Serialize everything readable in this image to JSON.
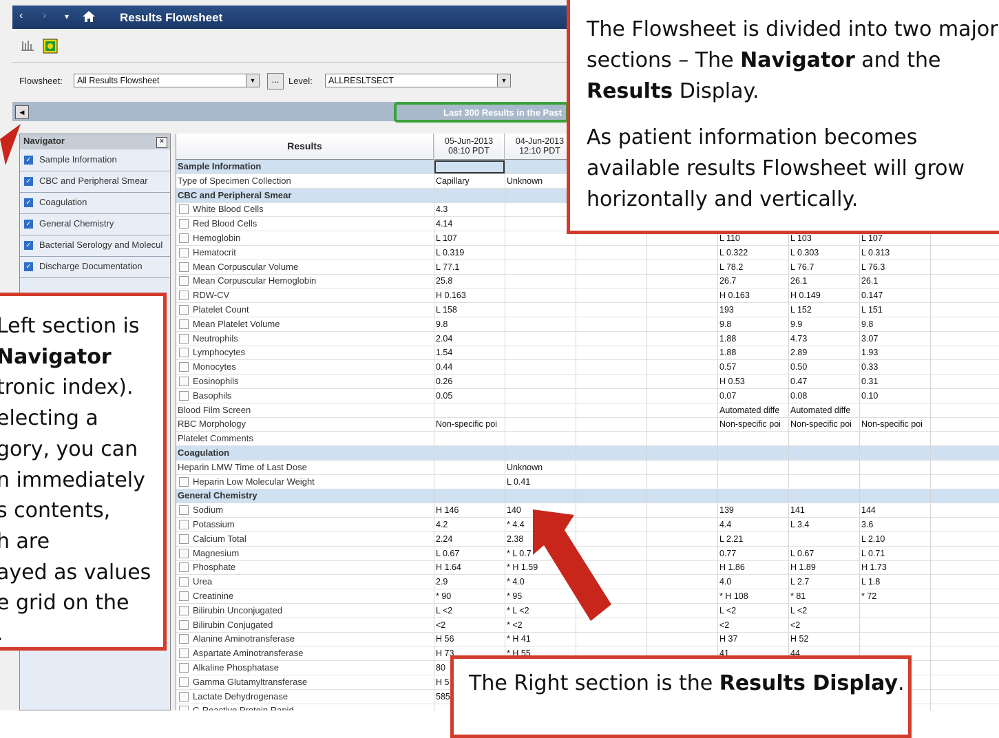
{
  "window": {
    "title": "Results Flowsheet",
    "back_arrow": "‹",
    "forward_arrow": "›",
    "dropdown_arrow": "▾",
    "home_icon": "home-icon"
  },
  "filters": {
    "flowsheet_label": "Flowsheet:",
    "flowsheet_value": "All Results Flowsheet",
    "ellipsis": "...",
    "level_label": "Level:",
    "level_value": "ALLRESLTSECT",
    "range_label": "Last 300 Results in the Past"
  },
  "navigator": {
    "title": "Navigator",
    "items": [
      {
        "label": "Sample Information"
      },
      {
        "label": "CBC and Peripheral Smear"
      },
      {
        "label": "Coagulation"
      },
      {
        "label": "General Chemistry"
      },
      {
        "label": "Bacterial Serology and Molecul"
      },
      {
        "label": "Discharge Documentation"
      }
    ]
  },
  "grid": {
    "results_header": "Results",
    "column_headers": [
      {
        "date": "05-Jun-2013",
        "time": "08:10 PDT"
      },
      {
        "date": "04-Jun-2013",
        "time": "12:10 PDT"
      }
    ],
    "rows": [
      {
        "type": "section",
        "name": "Sample Information",
        "values": [
          "",
          "",
          "",
          "",
          "",
          "",
          ""
        ]
      },
      {
        "type": "plain",
        "name": "Type of Specimen Collection",
        "values": [
          "Capillary",
          "Unknown",
          "",
          "",
          "",
          "",
          ""
        ]
      },
      {
        "type": "section",
        "name": "CBC and Peripheral Smear",
        "values": [
          "",
          "",
          "",
          "",
          "",
          "",
          ""
        ]
      },
      {
        "type": "check",
        "name": "White Blood Cells",
        "values": [
          "4.3",
          "",
          "",
          "",
          "",
          "",
          ""
        ]
      },
      {
        "type": "check",
        "name": "Red Blood Cells",
        "values": [
          "4.14",
          "",
          "",
          "",
          "",
          "",
          ""
        ]
      },
      {
        "type": "check",
        "name": "Hemoglobin",
        "values": [
          "L 107",
          "",
          "",
          "",
          "L 110",
          "L 103",
          "L 107"
        ]
      },
      {
        "type": "check",
        "name": "Hematocrit",
        "values": [
          "L 0.319",
          "",
          "",
          "",
          "L 0.322",
          "L 0.303",
          "L 0.313"
        ]
      },
      {
        "type": "check",
        "name": "Mean Corpuscular Volume",
        "values": [
          "L 77.1",
          "",
          "",
          "",
          "L 78.2",
          "L 76.7",
          "L 76.3"
        ]
      },
      {
        "type": "check",
        "name": "Mean Corpuscular Hemoglobin",
        "values": [
          "25.8",
          "",
          "",
          "",
          "26.7",
          "26.1",
          "26.1"
        ]
      },
      {
        "type": "check",
        "name": "RDW-CV",
        "values": [
          "H 0.163",
          "",
          "",
          "",
          "H 0.163",
          "H 0.149",
          "0.147"
        ]
      },
      {
        "type": "check",
        "name": "Platelet Count",
        "values": [
          "L 158",
          "",
          "",
          "",
          "193",
          "L 152",
          "L 151"
        ]
      },
      {
        "type": "check",
        "name": "Mean Platelet Volume",
        "values": [
          "9.8",
          "",
          "",
          "",
          "9.8",
          "9.9",
          "9.8"
        ]
      },
      {
        "type": "check",
        "name": "Neutrophils",
        "values": [
          "2.04",
          "",
          "",
          "",
          "1.88",
          "4.73",
          "3.07"
        ]
      },
      {
        "type": "check",
        "name": "Lymphocytes",
        "values": [
          "1.54",
          "",
          "",
          "",
          "1.88",
          "2.89",
          "1.93"
        ]
      },
      {
        "type": "check",
        "name": "Monocytes",
        "values": [
          "0.44",
          "",
          "",
          "",
          "0.57",
          "0.50",
          "0.33"
        ]
      },
      {
        "type": "check",
        "name": "Eosinophils",
        "values": [
          "0.26",
          "",
          "",
          "",
          "H 0.53",
          "0.47",
          "0.31"
        ]
      },
      {
        "type": "check",
        "name": "Basophils",
        "values": [
          "0.05",
          "",
          "",
          "",
          "0.07",
          "0.08",
          "0.10"
        ]
      },
      {
        "type": "plain",
        "name": "Blood Film Screen",
        "values": [
          "",
          "",
          "",
          "",
          "Automated diffe",
          "Automated diffe",
          ""
        ]
      },
      {
        "type": "plain",
        "name": "RBC Morphology",
        "values": [
          "Non-specific poi",
          "",
          "",
          "",
          "Non-specific poi",
          "Non-specific poi",
          "Non-specific poi"
        ]
      },
      {
        "type": "plain",
        "name": "Platelet Comments",
        "values": [
          "",
          "",
          "",
          "",
          "",
          "",
          ""
        ]
      },
      {
        "type": "section",
        "name": "Coagulation",
        "values": [
          "",
          "",
          "",
          "",
          "",
          "",
          ""
        ]
      },
      {
        "type": "plain",
        "name": "Heparin LMW Time of Last Dose",
        "values": [
          "",
          "Unknown",
          "",
          "",
          "",
          "",
          ""
        ]
      },
      {
        "type": "check",
        "name": "Heparin Low Molecular Weight",
        "values": [
          "",
          "L 0.41",
          "",
          "",
          "",
          "",
          ""
        ]
      },
      {
        "type": "section",
        "name": "General Chemistry",
        "values": [
          "",
          "",
          "",
          "",
          "",
          "",
          ""
        ]
      },
      {
        "type": "check",
        "name": "Sodium",
        "values": [
          "H 146",
          "140",
          "",
          "",
          "139",
          "141",
          "144"
        ]
      },
      {
        "type": "check",
        "name": "Potassium",
        "values": [
          "4.2",
          "* 4.4",
          "",
          "",
          "4.4",
          "L 3.4",
          "3.6"
        ]
      },
      {
        "type": "check",
        "name": "Calcium Total",
        "values": [
          "2.24",
          "2.38",
          "",
          "",
          "L 2.21",
          "",
          "L 2.10"
        ]
      },
      {
        "type": "check",
        "name": "Magnesium",
        "values": [
          "L 0.67",
          "* L 0.7",
          "",
          "",
          "0.77",
          "L 0.67",
          "L 0.71"
        ]
      },
      {
        "type": "check",
        "name": "Phosphate",
        "values": [
          "H 1.64",
          "* H 1.59",
          "",
          "",
          "H 1.86",
          "H 1.89",
          "H 1.73"
        ]
      },
      {
        "type": "check",
        "name": "Urea",
        "values": [
          "2.9",
          "* 4.0",
          "",
          "",
          "4.0",
          "L 2.7",
          "L 1.8"
        ]
      },
      {
        "type": "check",
        "name": "Creatinine",
        "values": [
          "* 90",
          "* 95",
          "",
          "",
          "* H 108",
          "* 81",
          "* 72"
        ]
      },
      {
        "type": "check",
        "name": "Bilirubin Unconjugated",
        "values": [
          "L <2",
          "* L <2",
          "",
          "",
          "L <2",
          "L <2",
          ""
        ]
      },
      {
        "type": "check",
        "name": "Bilirubin Conjugated",
        "values": [
          "<2",
          "* <2",
          "",
          "",
          "<2",
          "<2",
          ""
        ]
      },
      {
        "type": "check",
        "name": "Alanine Aminotransferase",
        "values": [
          "H 56",
          "* H 41",
          "",
          "",
          "H 37",
          "H 52",
          ""
        ]
      },
      {
        "type": "check",
        "name": "Aspartate Aminotransferase",
        "values": [
          "H 73",
          "* H 55",
          "",
          "",
          "41",
          "44",
          ""
        ]
      },
      {
        "type": "check",
        "name": "Alkaline Phosphatase",
        "values": [
          "80",
          "",
          "",
          "",
          "",
          "",
          ""
        ]
      },
      {
        "type": "check",
        "name": "Gamma Glutamyltransferase",
        "values": [
          "H 5",
          "",
          "",
          "",
          "",
          "",
          ""
        ]
      },
      {
        "type": "check",
        "name": "Lactate Dehydrogenase",
        "values": [
          "585",
          "",
          "",
          "",
          "",
          "",
          ""
        ]
      },
      {
        "type": "check",
        "name": "C-Reactive Protein Rapid",
        "values": [
          "",
          "",
          "",
          "",
          "",
          "",
          ""
        ]
      }
    ]
  },
  "callouts": {
    "top": {
      "p1_a": "The Flowsheet is divided into two major sections – The ",
      "p1_b": "Navigator",
      "p1_c": " and the ",
      "p1_d": "Results",
      "p1_e": " Display.",
      "p2": "As patient information becomes available results Flowsheet will grow horizontally and vertically."
    },
    "left": {
      "lines": [
        "Left section is",
        "Navigator",
        "tronic index).",
        "electing a",
        "gory, you can",
        "n immediately",
        "s contents,",
        "h are",
        "ayed as values",
        "e grid on the",
        "."
      ]
    },
    "bottom": {
      "a": "The Right section is the ",
      "b": "Results Display",
      "c": "."
    }
  },
  "colors": {
    "callout_border": "#d23c2c",
    "range_highlight": "#3aa238",
    "low_value": "#2758d6",
    "high_value": "#e9661f"
  }
}
